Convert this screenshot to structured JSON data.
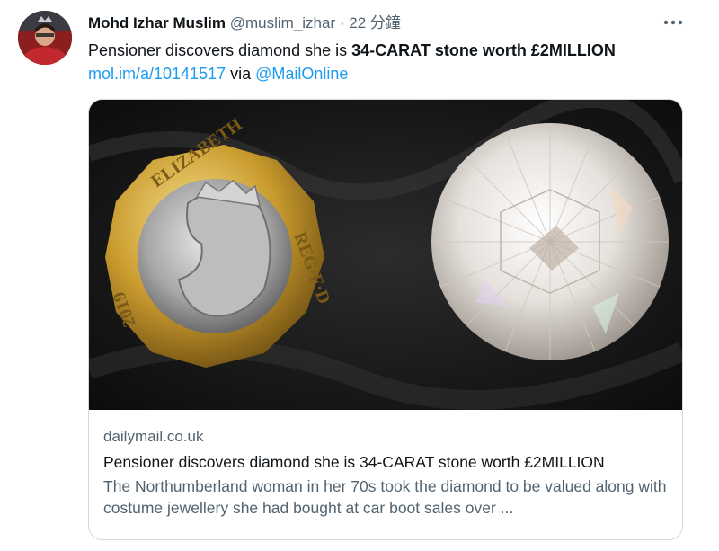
{
  "author": {
    "name": "Mohd Izhar Muslim",
    "handle": "@muslim_izhar",
    "separator": "·",
    "time": "22 分鐘"
  },
  "tweet": {
    "text_plain": "Pensioner discovers diamond she is ",
    "text_bold": "34-CARAT stone worth £2MILLION",
    "link": "mol.im/a/10141517",
    "via": " via ",
    "mention": "@MailOnline"
  },
  "card": {
    "domain": "dailymail.co.uk",
    "title": "Pensioner discovers diamond she is 34-CARAT stone worth £2MILLION",
    "description": "The Northumberland woman in her 70s took the diamond to be valued along with costume jewellery she had bought at car boot sales over ...",
    "coin_text": "ELIZABETH II · D · G · REG · F · D",
    "coin_year": "2019"
  },
  "icons": {
    "more": "more-icon"
  }
}
